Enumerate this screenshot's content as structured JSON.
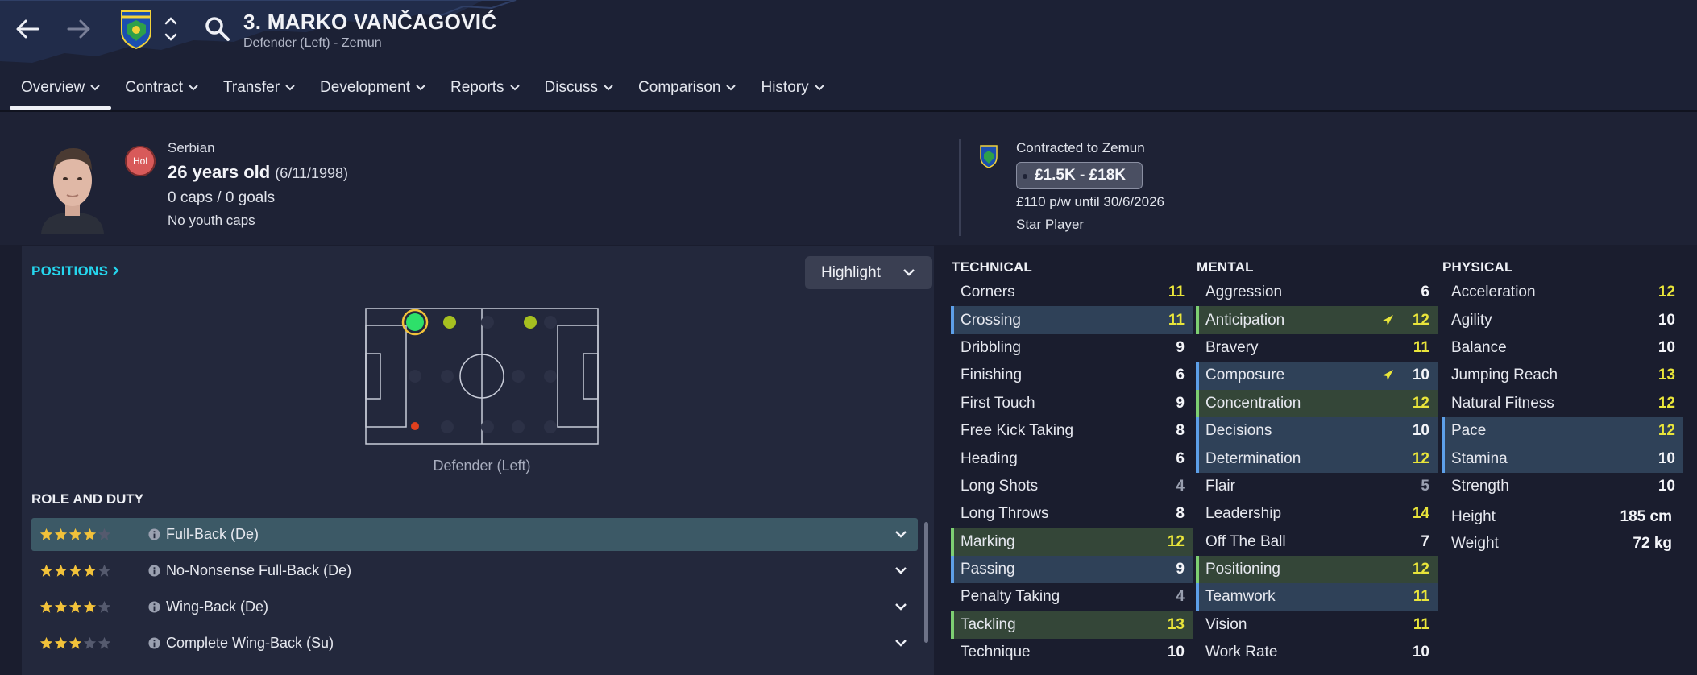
{
  "header": {
    "player_name": "3. MARKO VANČAGOVIĆ",
    "player_subtitle": "Defender (Left) - Zemun",
    "tabs": [
      {
        "label": "Overview"
      },
      {
        "label": "Contract"
      },
      {
        "label": "Transfer"
      },
      {
        "label": "Development"
      },
      {
        "label": "Reports"
      },
      {
        "label": "Discuss"
      },
      {
        "label": "Comparison"
      },
      {
        "label": "History"
      }
    ]
  },
  "profile": {
    "badge": "Hol",
    "nationality": "Serbian",
    "age": "26 years old",
    "dob": "(6/11/1998)",
    "caps": "0 caps / 0 goals",
    "youth_caps": "No youth caps",
    "contracted_to": "Contracted to Zemun",
    "value": "£1.5K - £18K",
    "wage": "£110 p/w until 30/6/2026",
    "status": "Star Player"
  },
  "positions": {
    "link": "POSITIONS",
    "highlight_label": "Highlight",
    "pitch_label": "Defender (Left)"
  },
  "roles": {
    "title": "ROLE AND DUTY",
    "items": [
      {
        "name": "Full-Back (De)",
        "stars": 4
      },
      {
        "name": "No-Nonsense Full-Back (De)",
        "stars": 4
      },
      {
        "name": "Wing-Back (De)",
        "stars": 4
      },
      {
        "name": "Complete Wing-Back (Su)",
        "stars": 3
      }
    ]
  },
  "technical": {
    "title": "TECHNICAL",
    "items": [
      {
        "name": "Corners",
        "value": "11"
      },
      {
        "name": "Crossing",
        "value": "11"
      },
      {
        "name": "Dribbling",
        "value": "9"
      },
      {
        "name": "Finishing",
        "value": "6"
      },
      {
        "name": "First Touch",
        "value": "9"
      },
      {
        "name": "Free Kick Taking",
        "value": "8"
      },
      {
        "name": "Heading",
        "value": "6"
      },
      {
        "name": "Long Shots",
        "value": "4"
      },
      {
        "name": "Long Throws",
        "value": "8"
      },
      {
        "name": "Marking",
        "value": "12"
      },
      {
        "name": "Passing",
        "value": "9"
      },
      {
        "name": "Penalty Taking",
        "value": "4"
      },
      {
        "name": "Tackling",
        "value": "13"
      },
      {
        "name": "Technique",
        "value": "10"
      }
    ]
  },
  "mental": {
    "title": "MENTAL",
    "items": [
      {
        "name": "Aggression",
        "value": "6"
      },
      {
        "name": "Anticipation",
        "value": "12"
      },
      {
        "name": "Bravery",
        "value": "11"
      },
      {
        "name": "Composure",
        "value": "10"
      },
      {
        "name": "Concentration",
        "value": "12"
      },
      {
        "name": "Decisions",
        "value": "10"
      },
      {
        "name": "Determination",
        "value": "12"
      },
      {
        "name": "Flair",
        "value": "5"
      },
      {
        "name": "Leadership",
        "value": "14"
      },
      {
        "name": "Off The Ball",
        "value": "7"
      },
      {
        "name": "Positioning",
        "value": "12"
      },
      {
        "name": "Teamwork",
        "value": "11"
      },
      {
        "name": "Vision",
        "value": "11"
      },
      {
        "name": "Work Rate",
        "value": "10"
      }
    ]
  },
  "physical": {
    "title": "PHYSICAL",
    "items": [
      {
        "name": "Acceleration",
        "value": "12"
      },
      {
        "name": "Agility",
        "value": "10"
      },
      {
        "name": "Balance",
        "value": "10"
      },
      {
        "name": "Jumping Reach",
        "value": "13"
      },
      {
        "name": "Natural Fitness",
        "value": "12"
      },
      {
        "name": "Pace",
        "value": "12"
      },
      {
        "name": "Stamina",
        "value": "10"
      },
      {
        "name": "Strength",
        "value": "10"
      }
    ],
    "height_label": "Height",
    "height": "185 cm",
    "weight_label": "Weight",
    "weight": "72 kg"
  },
  "colors": {
    "background": "#1a1d2e",
    "accent_cyan": "#25d6ee",
    "value_yellow": "#e9e53a",
    "highlight_blue": "#5d9fe8",
    "highlight_green": "#7dcf72",
    "star_gold": "#f2c23a"
  }
}
